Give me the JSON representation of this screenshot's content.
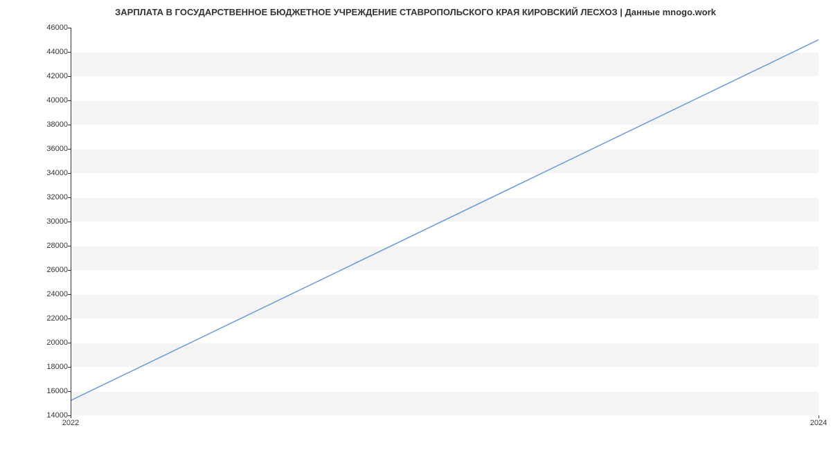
{
  "chart_data": {
    "type": "line",
    "title": "ЗАРПЛАТА В ГОСУДАРСТВЕННОЕ БЮДЖЕТНОЕ УЧРЕЖДЕНИЕ СТАВРОПОЛЬСКОГО КРАЯ КИРОВСКИЙ ЛЕСХОЗ | Данные mnogo.work",
    "x": [
      2022,
      2024
    ],
    "values": [
      15200,
      45000
    ],
    "xlabel": "",
    "ylabel": "",
    "xlim": [
      2022,
      2024
    ],
    "ylim": [
      14000,
      46000
    ],
    "y_ticks": [
      14000,
      16000,
      18000,
      20000,
      22000,
      24000,
      26000,
      28000,
      30000,
      32000,
      34000,
      36000,
      38000,
      40000,
      42000,
      44000,
      46000
    ],
    "x_ticks": [
      2022,
      2024
    ],
    "line_color": "#6699e0"
  }
}
